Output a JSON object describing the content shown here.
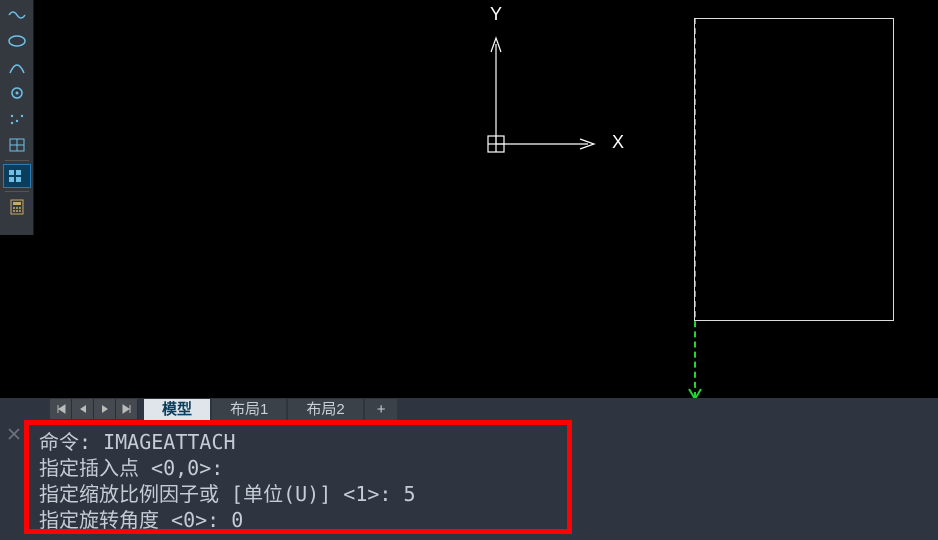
{
  "toolbar": {
    "items": [
      {
        "name": "snap-nearest-icon"
      },
      {
        "name": "snap-ellipse-icon"
      },
      {
        "name": "snap-arc-icon"
      },
      {
        "name": "snap-center-icon"
      },
      {
        "name": "snap-dot-icon"
      },
      {
        "name": "grid-toggle-icon"
      },
      {
        "name": "grid-display-icon"
      },
      {
        "name": "calc-icon"
      }
    ]
  },
  "axes": {
    "x": "X",
    "y": "Y"
  },
  "tabs": {
    "model": "模型",
    "layout1": "布局1",
    "layout2": "布局2",
    "plus": "+"
  },
  "command": {
    "line1": "命令: IMAGEATTACH",
    "line2": "指定插入点 <0,0>:",
    "line3": "指定缩放比例因子或 [单位(U)] <1>: 5",
    "line4": "指定旋转角度 <0>: 0"
  }
}
